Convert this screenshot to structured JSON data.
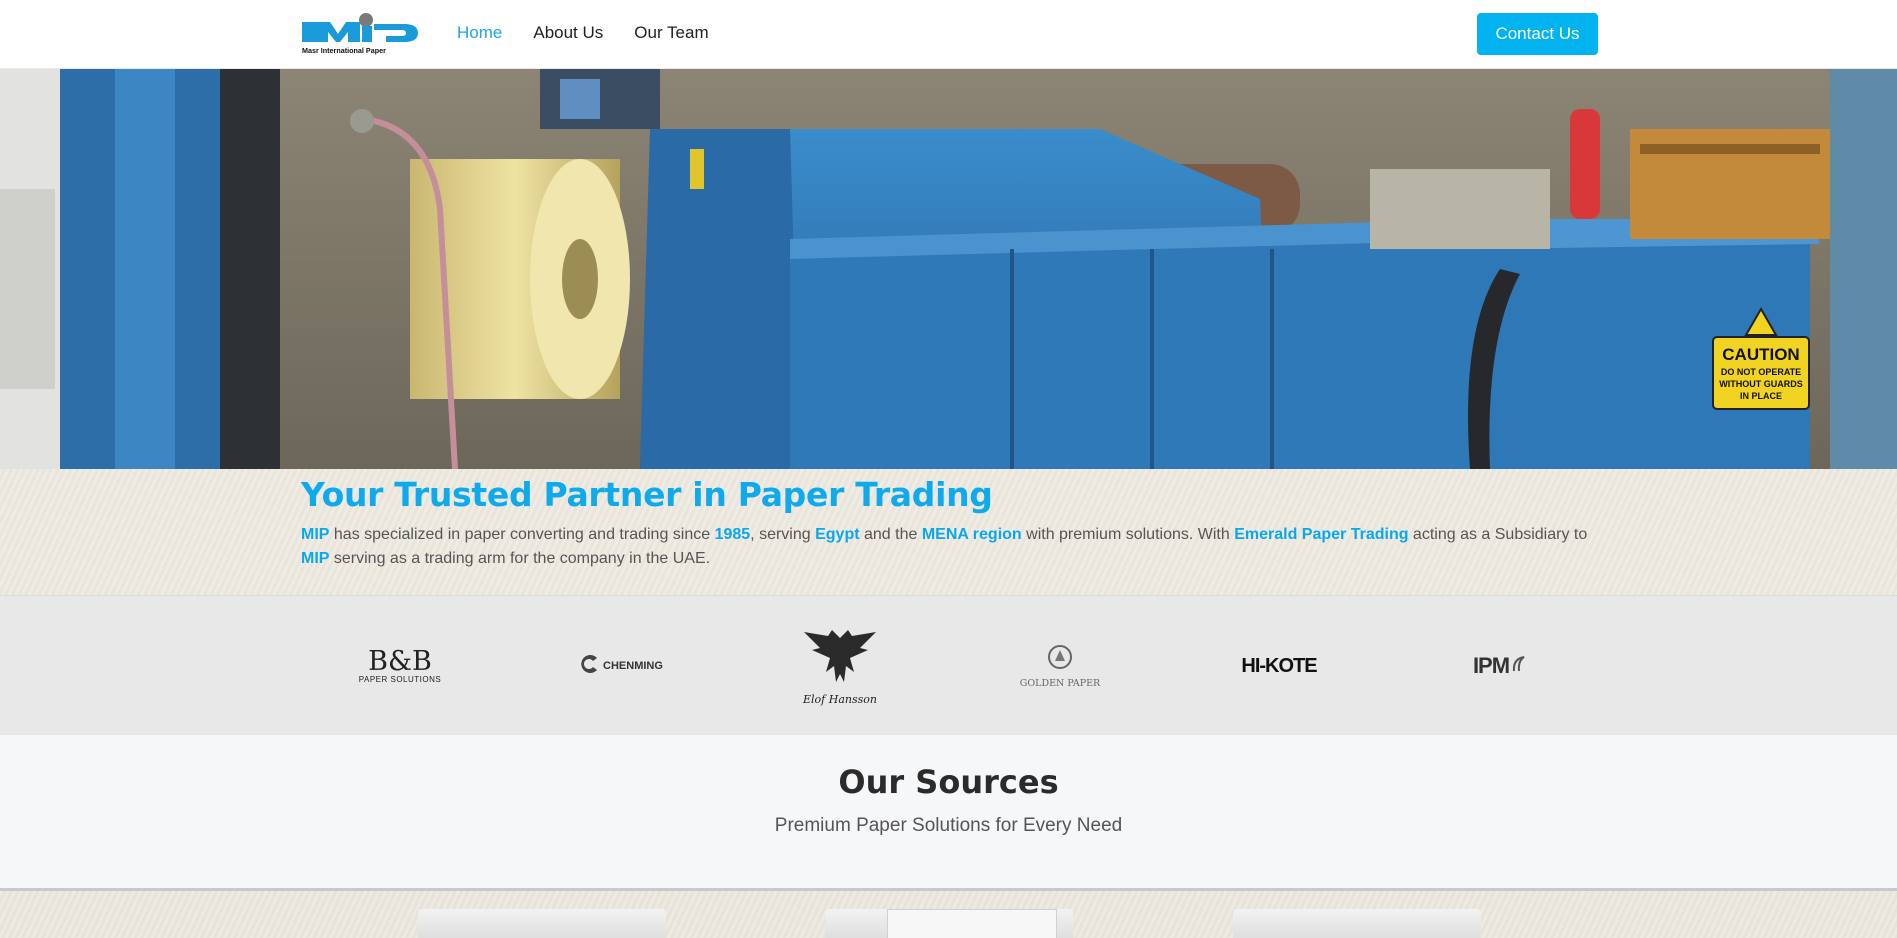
{
  "header": {
    "logo_text": "MIP",
    "logo_subtext": "Masr International Paper",
    "nav": [
      {
        "label": "Home",
        "active": true
      },
      {
        "label": "About Us",
        "active": false
      },
      {
        "label": "Our Team",
        "active": false
      }
    ],
    "cta_label": "Contact Us"
  },
  "hero": {
    "sign": [
      "CAUTION",
      "DO NOT OPERATE",
      "WITHOUT GUARDS",
      "IN PLACE"
    ]
  },
  "intro": {
    "title": "Your Trusted Partner in Paper Trading",
    "p_1": "MIP",
    "p_2": " has specialized in paper converting and trading since ",
    "p_3": "1985",
    "p_4": ", serving ",
    "p_5": "Egypt",
    "p_6": " and the ",
    "p_7": "MENA region",
    "p_8": " with premium solutions. With ",
    "p_9": "Emerald Paper Trading",
    "p_10": " acting as a Subsidiary to ",
    "p_11": "MIP",
    "p_12": " serving as a trading arm for the company in the UAE."
  },
  "partners": {
    "bb_main": "B&B",
    "bb_sub": "PAPER SOLUTIONS",
    "chenming": "CHENMING",
    "elof": "Elof Hansson",
    "golden": "GOLDEN PAPER",
    "hikote": "HI-KOTE",
    "ipm": "IPM"
  },
  "sources": {
    "title": "Our Sources",
    "subtitle": "Premium Paper Solutions for Every Need"
  },
  "colors": {
    "accent": "#03b3ef",
    "accent_text": "#0aa8e8",
    "machine_blue": "#2f79b8"
  },
  "icons": [
    "mip-logo",
    "eagle-icon",
    "golden-paper-emblem",
    "chenming-icon"
  ]
}
